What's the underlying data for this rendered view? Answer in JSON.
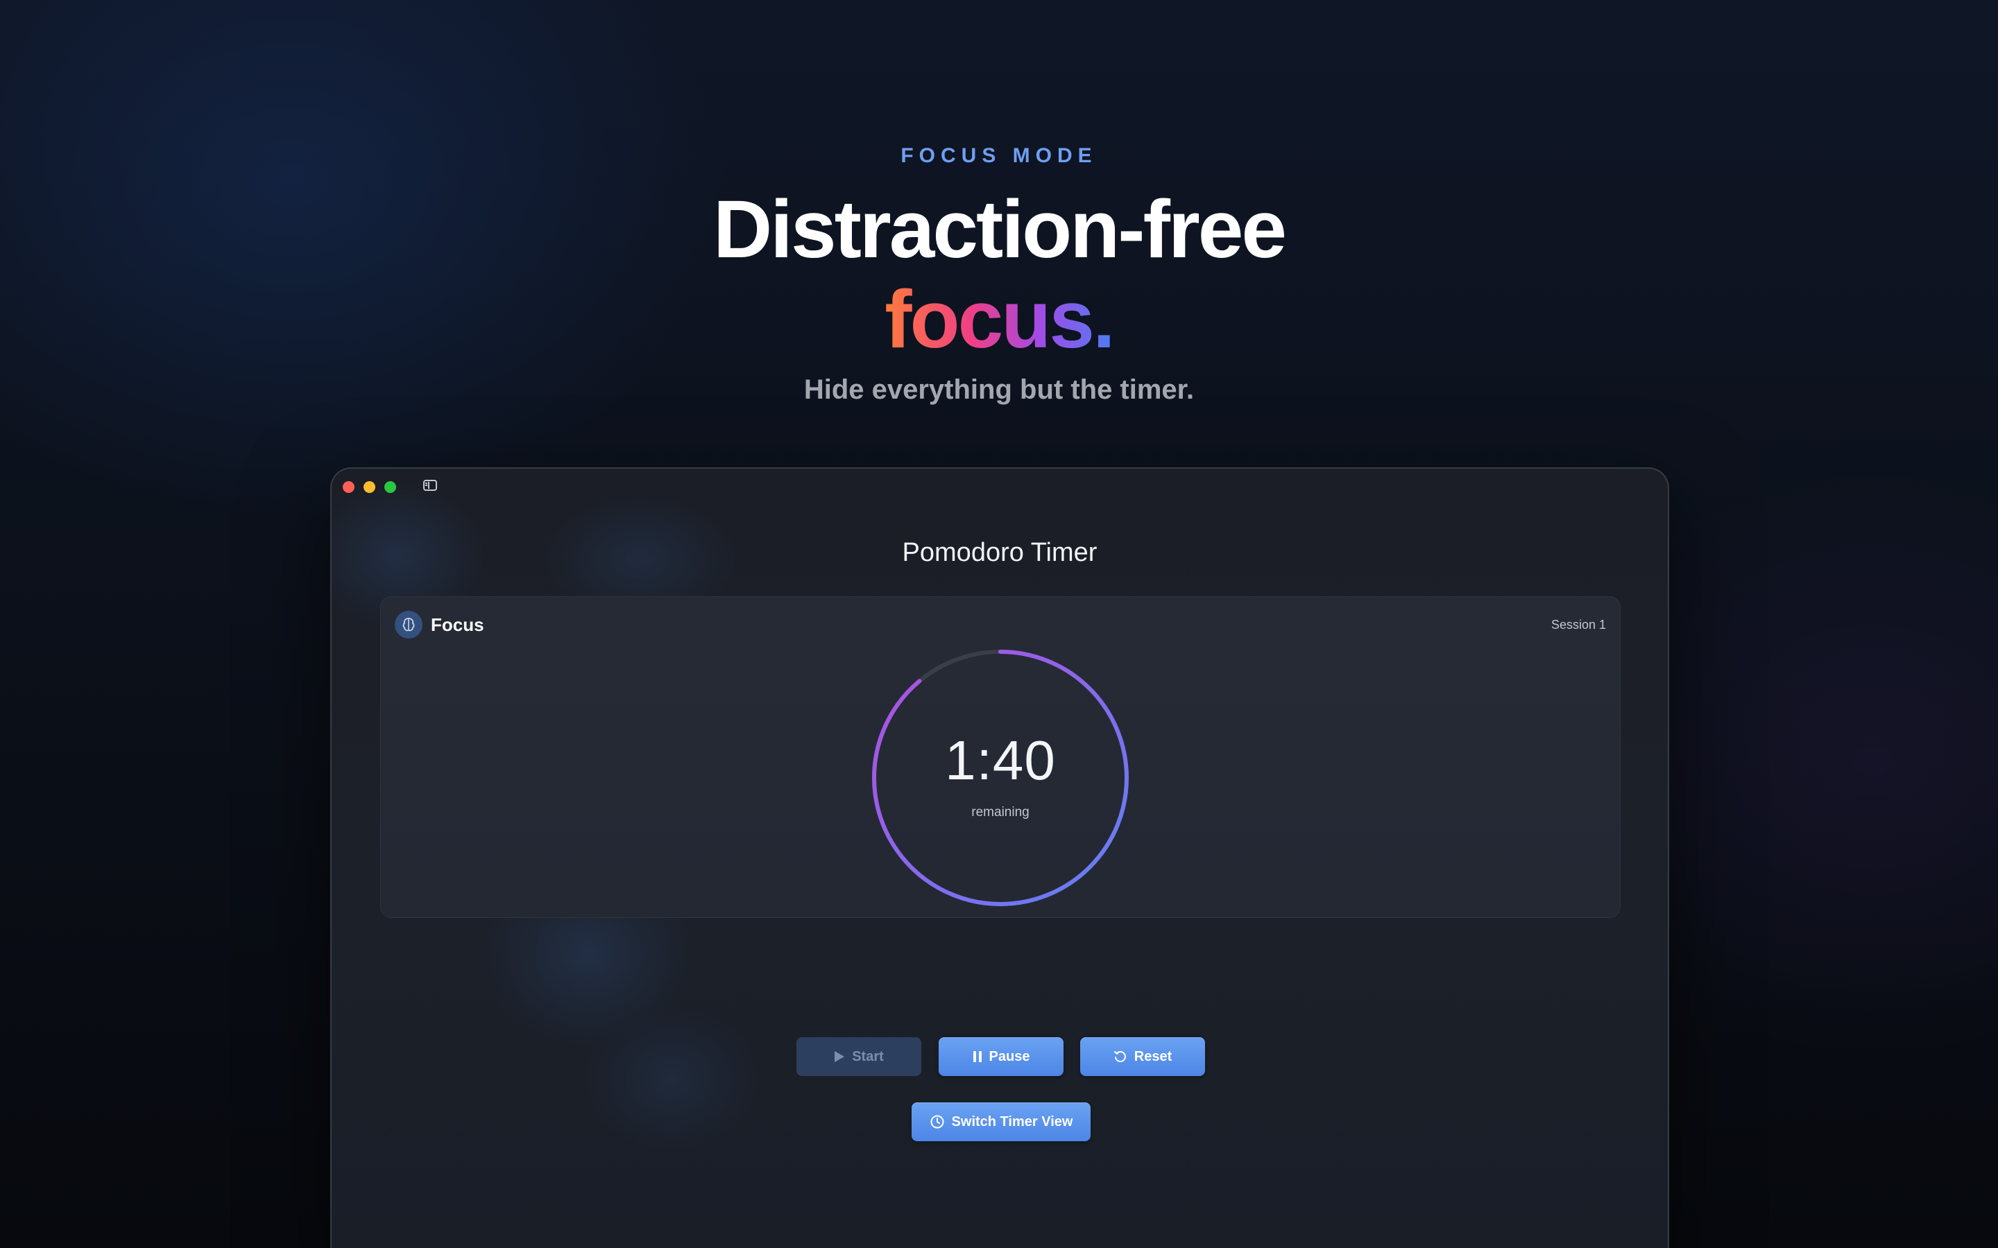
{
  "hero": {
    "eyebrow": "FOCUS MODE",
    "headline_line1": "Distraction-free",
    "headline_line2": "focus.",
    "subtitle": "Hide everything but the timer."
  },
  "window": {
    "title": "Pomodoro Timer",
    "controls": [
      "close",
      "minimize",
      "maximize"
    ],
    "sidebar_toggle_icon": "sidebar-left-icon"
  },
  "card": {
    "mode_icon": "brain-icon",
    "mode_label": "Focus",
    "session_label": "Session 1",
    "timer": {
      "time": "1:40",
      "subtitle": "remaining",
      "progress_fraction": 0.889,
      "gradient_start": "#5f82f6",
      "gradient_end": "#b14fe0",
      "track_color": "#3a3e4a"
    }
  },
  "controls": {
    "start_label": "Start",
    "start_icon": "play-icon",
    "start_enabled": false,
    "pause_label": "Pause",
    "pause_icon": "pause-icon",
    "reset_label": "Reset",
    "reset_icon": "reset-icon",
    "switch_label": "Switch Timer View",
    "switch_icon": "timer-icon"
  },
  "colors": {
    "accent_blue": "#5b93ee",
    "eyebrow_blue": "#6e9ff2",
    "close": "#fe5f57",
    "minimize": "#febc2e",
    "maximize": "#28c840"
  }
}
